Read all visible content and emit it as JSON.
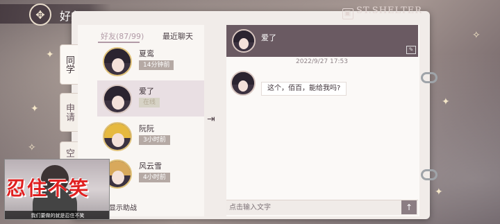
{
  "header": {
    "title": "好友"
  },
  "brand": {
    "text": "ST.SHELTER"
  },
  "side_tabs": [
    {
      "label": "同学"
    },
    {
      "label": "申请"
    },
    {
      "label": "空"
    }
  ],
  "list": {
    "tab_friends": "好友(87/99)",
    "tab_recent": "最近聊天",
    "friends": [
      {
        "name": "夏鸾",
        "status": "14分钟前"
      },
      {
        "name": "爱了",
        "status": "在线"
      },
      {
        "name": "阮阮",
        "status": "3小时前"
      },
      {
        "name": "风云雪",
        "status": "4小时前"
      }
    ],
    "show_assist": "显示助战"
  },
  "chat": {
    "contact_name": "爱了",
    "timestamp": "2022/9/27  17:53",
    "message": "这个，佰百，能给我吗?",
    "input_placeholder": "点击输入文字",
    "send_icon": "arrow-up-icon"
  },
  "overlay": {
    "big_text": "忍住不笑",
    "subtitle": "我们要做的就是忍住不笑"
  }
}
